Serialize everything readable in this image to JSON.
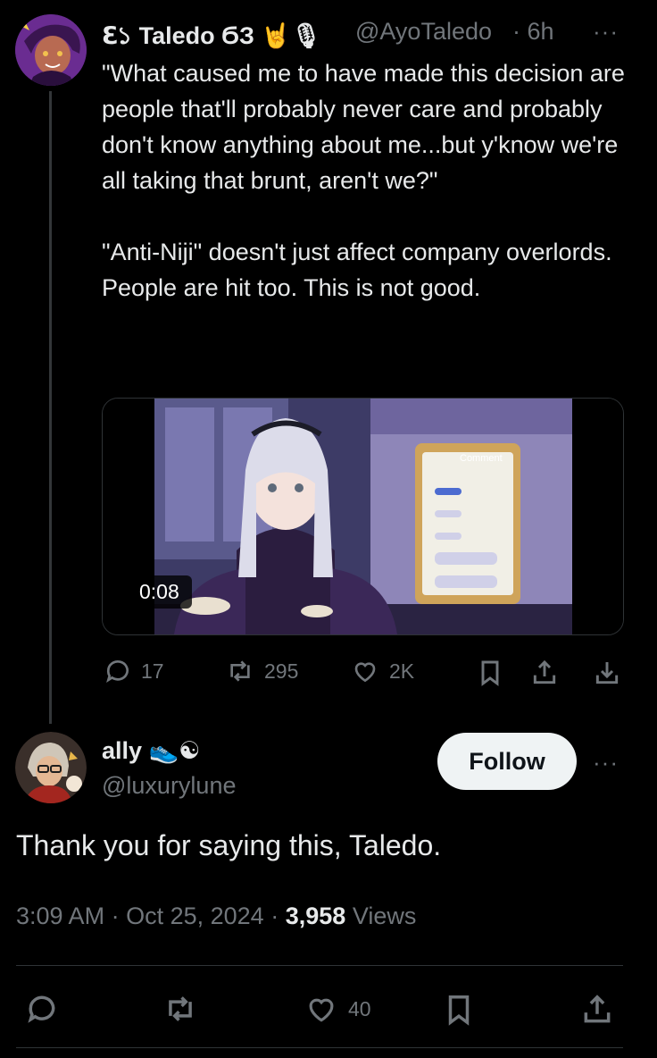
{
  "quoted_tweet": {
    "display_name": "ℇ১ Taledo ϬЗ 🤘🎙",
    "handle": "@AyoTaledo",
    "time": "· 6h",
    "more": "···",
    "text": "\"What caused me to have made this decision are people that'll probably never care and probably don't know anything about me...but y'know we're all taking that brunt, aren't we?\"\n\n\"Anti-Niji\" doesn't just affect company overlords. People are hit too. This is not good.",
    "video_duration": "0:08",
    "video_overlay_text": "Comment",
    "stats": {
      "replies": "17",
      "reposts": "295",
      "likes": "2K"
    }
  },
  "reply_tweet": {
    "display_name": "ally 👟☯",
    "handle": "@luxurylune",
    "follow_label": "Follow",
    "more": "···",
    "text": "Thank you for saying this, Taledo.",
    "time": "3:09 AM",
    "date": "Oct 25, 2024",
    "views_count": "3,958",
    "views_label": "Views",
    "stats": {
      "likes": "40"
    }
  },
  "colors": {
    "background": "#000000",
    "text": "#e7e9ea",
    "muted": "#71767b",
    "border": "#2f3336",
    "follow_bg": "#eff3f4"
  },
  "icons": [
    "reply-icon",
    "repost-icon",
    "like-icon",
    "bookmark-icon",
    "share-icon",
    "download-icon"
  ]
}
